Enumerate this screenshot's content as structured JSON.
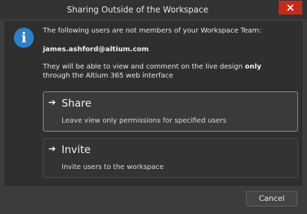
{
  "window": {
    "title": "Sharing Outside of the Workspace",
    "close_icon": "close-icon",
    "close_color": "#c42b1c"
  },
  "message": {
    "icon": "info-icon",
    "intro": "The following users are not members of your Workspace Team:",
    "email": "james.ashford@altium.com",
    "line1_before": "They will be able to view and comment on the live design ",
    "line1_bold": "only",
    "line2": "through the Altium 365 web interface"
  },
  "options": [
    {
      "icon": "arrow-right-icon",
      "title": "Share",
      "description": "Leave view only permissions for specified users",
      "selected": true
    },
    {
      "icon": "arrow-right-icon",
      "title": "Invite",
      "description": "Invite users to the workspace",
      "selected": false
    }
  ],
  "footer": {
    "cancel_label": "Cancel"
  },
  "colors": {
    "accent_border": "#6a9bd1",
    "info_blue": "#2f7fc4"
  }
}
